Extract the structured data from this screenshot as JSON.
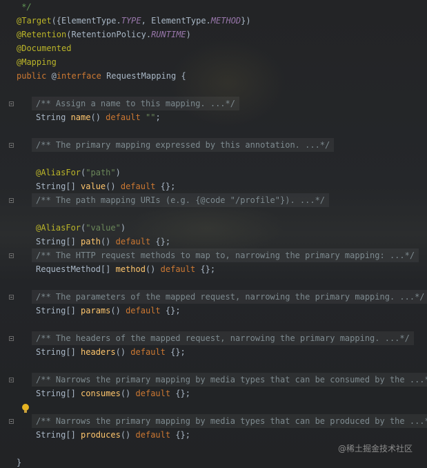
{
  "code": {
    "comment_close": " */",
    "target": {
      "at": "@Target",
      "open": "({ElementType.",
      "type": "TYPE",
      "sep": ", ElementType.",
      "method": "METHOD",
      "close": "})"
    },
    "retention": {
      "at": "@Retention",
      "open": "(RetentionPolicy.",
      "runtime": "RUNTIME",
      "close": ")"
    },
    "documented": "@Documented",
    "mapping": "@Mapping",
    "decl": {
      "public": "public",
      "at": " @",
      "iface": "interface",
      "name": " RequestMapping {"
    },
    "members": [
      {
        "doc": "/** Assign a name to this mapping. ...*/",
        "type": "String ",
        "method": "name",
        "tail": "() ",
        "default": "default",
        "value": " \"\"",
        "end": ";"
      },
      {
        "doc": "/** The primary mapping expressed by this annotation. ...*/",
        "alias": "@AliasFor",
        "alias_arg": "\"path\"",
        "type": "String[] ",
        "method": "value",
        "tail": "() ",
        "default": "default",
        "end": " {};"
      },
      {
        "doc": "/** The path mapping URIs (e.g. {@code \"/profile\"}). ...*/",
        "alias": "@AliasFor",
        "alias_arg": "\"value\"",
        "type": "String[] ",
        "method": "path",
        "tail": "() ",
        "default": "default",
        "end": " {};"
      },
      {
        "doc": "/** The HTTP request methods to map to, narrowing the primary mapping: ...*/",
        "type": "RequestMethod[] ",
        "method": "method",
        "tail": "() ",
        "default": "default",
        "end": " {};"
      },
      {
        "doc": "/** The parameters of the mapped request, narrowing the primary mapping. ...*/",
        "type": "String[] ",
        "method": "params",
        "tail": "() ",
        "default": "default",
        "end": " {};"
      },
      {
        "doc": "/** The headers of the mapped request, narrowing the primary mapping. ...*/",
        "type": "String[] ",
        "method": "headers",
        "tail": "() ",
        "default": "default",
        "end": " {};"
      },
      {
        "doc": "/** Narrows the primary mapping by media types that can be consumed by the ...*/",
        "type": "String[] ",
        "method": "consumes",
        "tail": "() ",
        "default": "default",
        "end": " {};"
      },
      {
        "doc": "/** Narrows the primary mapping by media types that can be produced by the ...*/",
        "type": "String[] ",
        "method": "produces",
        "tail": "() ",
        "default": "default",
        "end": " {};"
      }
    ],
    "closing_brace": "}"
  },
  "watermark": "@稀土掘金技术社区",
  "icons": {
    "fold": "fold-marker-icon",
    "bulb": "lightbulb-icon"
  },
  "colors": {
    "keyword": "#cc7832",
    "annotation": "#bbb529",
    "string": "#6a8759",
    "method": "#ffc66d",
    "constant": "#9876aa",
    "text": "#a9b7c6"
  }
}
